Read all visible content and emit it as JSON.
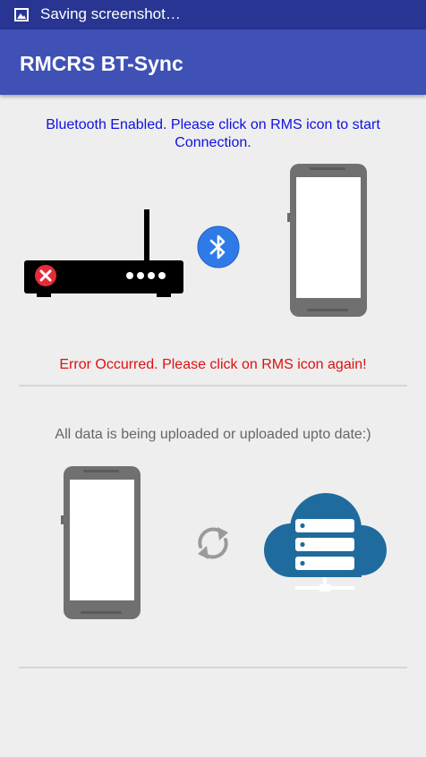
{
  "status_bar": {
    "notification_icon": "image-icon",
    "text": "Saving screenshot…"
  },
  "app_bar": {
    "title": "RMCRS BT-Sync"
  },
  "connection": {
    "status_message": "Bluetooth Enabled. Please click on RMS icon to start Connection.",
    "error_message": "Error Occurred. Please click on RMS icon again!",
    "device_icon": "rms-router-icon",
    "device_state_icon": "error-x-icon",
    "link_icon": "bluetooth-icon",
    "phone_icon": "phone-icon"
  },
  "sync": {
    "message": "All data is being uploaded or uploaded upto date:)",
    "phone_icon": "phone-icon",
    "sync_icon": "sync-icon",
    "cloud_icon": "cloud-server-icon"
  },
  "colors": {
    "status_bar": "#283593",
    "app_bar": "#3f51b5",
    "info_text": "#1010e0",
    "error_text": "#e01010",
    "bluetooth": "#2e7be8",
    "cloud": "#206b9e"
  }
}
